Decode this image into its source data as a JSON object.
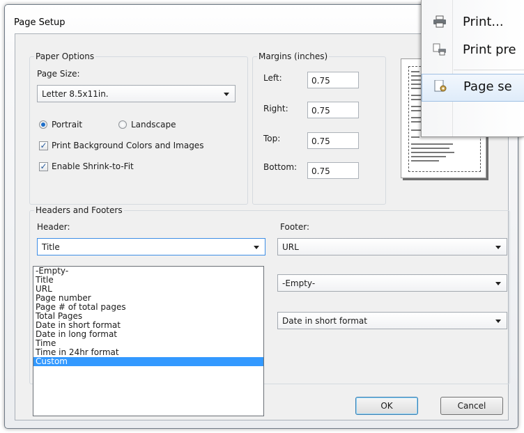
{
  "dialog": {
    "title": "Page Setup"
  },
  "paper_options": {
    "legend": "Paper Options",
    "page_size_label": "Page Size:",
    "page_size_value": "Letter 8.5x11in.",
    "portrait_label": "Portrait",
    "landscape_label": "Landscape",
    "orientation_selected": "Portrait",
    "print_bg_label": "Print Background Colors and Images",
    "print_bg_checked": true,
    "shrink_label": "Enable Shrink-to-Fit",
    "shrink_checked": true
  },
  "margins": {
    "legend": "Margins (inches)",
    "left_label": "Left:",
    "left_value": "0.75",
    "right_label": "Right:",
    "right_value": "0.75",
    "top_label": "Top:",
    "top_value": "0.75",
    "bottom_label": "Bottom:",
    "bottom_value": "0.75"
  },
  "headers_footers": {
    "legend": "Headers and Footers",
    "header_label": "Header:",
    "footer_label": "Footer:",
    "header_value": "Title",
    "footer_values": [
      "URL",
      "-Empty-",
      "Date in short format"
    ],
    "dropdown_options": [
      "-Empty-",
      "Title",
      "URL",
      "Page number",
      "Page # of total pages",
      "Total Pages",
      "Date in short format",
      "Date in long format",
      "Time",
      "Time in 24hr format",
      "Custom"
    ],
    "dropdown_highlighted": "Custom"
  },
  "buttons": {
    "ok": "OK",
    "cancel": "Cancel"
  },
  "context_menu": {
    "items": [
      {
        "label": "Print...",
        "icon": "printer-icon"
      },
      {
        "label": "Print pre",
        "icon": "print-preview-icon"
      },
      {
        "label": "Page se",
        "icon": "page-setup-icon"
      }
    ]
  },
  "colors": {
    "selection": "#3399ff",
    "focus_border": "#3d8ee6"
  }
}
